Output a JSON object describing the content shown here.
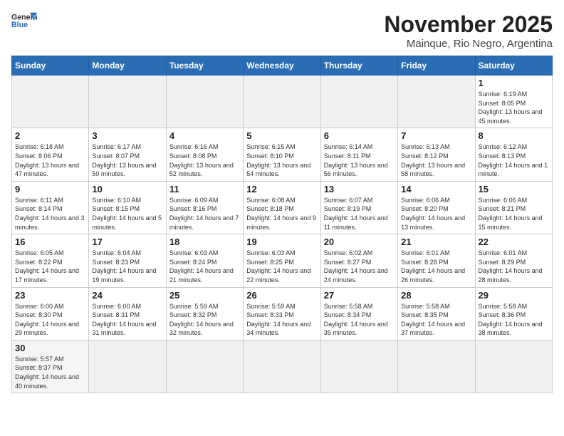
{
  "header": {
    "logo_line1": "General",
    "logo_line2": "Blue",
    "month": "November 2025",
    "location": "Mainque, Rio Negro, Argentina"
  },
  "weekdays": [
    "Sunday",
    "Monday",
    "Tuesday",
    "Wednesday",
    "Thursday",
    "Friday",
    "Saturday"
  ],
  "weeks": [
    [
      {
        "day": "",
        "info": ""
      },
      {
        "day": "",
        "info": ""
      },
      {
        "day": "",
        "info": ""
      },
      {
        "day": "",
        "info": ""
      },
      {
        "day": "",
        "info": ""
      },
      {
        "day": "",
        "info": ""
      },
      {
        "day": "1",
        "info": "Sunrise: 6:19 AM\nSunset: 8:05 PM\nDaylight: 13 hours and 45 minutes."
      }
    ],
    [
      {
        "day": "2",
        "info": "Sunrise: 6:18 AM\nSunset: 8:06 PM\nDaylight: 13 hours and 47 minutes."
      },
      {
        "day": "3",
        "info": "Sunrise: 6:17 AM\nSunset: 8:07 PM\nDaylight: 13 hours and 50 minutes."
      },
      {
        "day": "4",
        "info": "Sunrise: 6:16 AM\nSunset: 8:08 PM\nDaylight: 13 hours and 52 minutes."
      },
      {
        "day": "5",
        "info": "Sunrise: 6:15 AM\nSunset: 8:10 PM\nDaylight: 13 hours and 54 minutes."
      },
      {
        "day": "6",
        "info": "Sunrise: 6:14 AM\nSunset: 8:11 PM\nDaylight: 13 hours and 56 minutes."
      },
      {
        "day": "7",
        "info": "Sunrise: 6:13 AM\nSunset: 8:12 PM\nDaylight: 13 hours and 58 minutes."
      },
      {
        "day": "8",
        "info": "Sunrise: 6:12 AM\nSunset: 8:13 PM\nDaylight: 14 hours and 1 minute."
      }
    ],
    [
      {
        "day": "9",
        "info": "Sunrise: 6:11 AM\nSunset: 8:14 PM\nDaylight: 14 hours and 3 minutes."
      },
      {
        "day": "10",
        "info": "Sunrise: 6:10 AM\nSunset: 8:15 PM\nDaylight: 14 hours and 5 minutes."
      },
      {
        "day": "11",
        "info": "Sunrise: 6:09 AM\nSunset: 8:16 PM\nDaylight: 14 hours and 7 minutes."
      },
      {
        "day": "12",
        "info": "Sunrise: 6:08 AM\nSunset: 8:18 PM\nDaylight: 14 hours and 9 minutes."
      },
      {
        "day": "13",
        "info": "Sunrise: 6:07 AM\nSunset: 8:19 PM\nDaylight: 14 hours and 11 minutes."
      },
      {
        "day": "14",
        "info": "Sunrise: 6:06 AM\nSunset: 8:20 PM\nDaylight: 14 hours and 13 minutes."
      },
      {
        "day": "15",
        "info": "Sunrise: 6:06 AM\nSunset: 8:21 PM\nDaylight: 14 hours and 15 minutes."
      }
    ],
    [
      {
        "day": "16",
        "info": "Sunrise: 6:05 AM\nSunset: 8:22 PM\nDaylight: 14 hours and 17 minutes."
      },
      {
        "day": "17",
        "info": "Sunrise: 6:04 AM\nSunset: 8:23 PM\nDaylight: 14 hours and 19 minutes."
      },
      {
        "day": "18",
        "info": "Sunrise: 6:03 AM\nSunset: 8:24 PM\nDaylight: 14 hours and 21 minutes."
      },
      {
        "day": "19",
        "info": "Sunrise: 6:03 AM\nSunset: 8:25 PM\nDaylight: 14 hours and 22 minutes."
      },
      {
        "day": "20",
        "info": "Sunrise: 6:02 AM\nSunset: 8:27 PM\nDaylight: 14 hours and 24 minutes."
      },
      {
        "day": "21",
        "info": "Sunrise: 6:01 AM\nSunset: 8:28 PM\nDaylight: 14 hours and 26 minutes."
      },
      {
        "day": "22",
        "info": "Sunrise: 6:01 AM\nSunset: 8:29 PM\nDaylight: 14 hours and 28 minutes."
      }
    ],
    [
      {
        "day": "23",
        "info": "Sunrise: 6:00 AM\nSunset: 8:30 PM\nDaylight: 14 hours and 29 minutes."
      },
      {
        "day": "24",
        "info": "Sunrise: 6:00 AM\nSunset: 8:31 PM\nDaylight: 14 hours and 31 minutes."
      },
      {
        "day": "25",
        "info": "Sunrise: 5:59 AM\nSunset: 8:32 PM\nDaylight: 14 hours and 32 minutes."
      },
      {
        "day": "26",
        "info": "Sunrise: 5:59 AM\nSunset: 8:33 PM\nDaylight: 14 hours and 34 minutes."
      },
      {
        "day": "27",
        "info": "Sunrise: 5:58 AM\nSunset: 8:34 PM\nDaylight: 14 hours and 35 minutes."
      },
      {
        "day": "28",
        "info": "Sunrise: 5:58 AM\nSunset: 8:35 PM\nDaylight: 14 hours and 37 minutes."
      },
      {
        "day": "29",
        "info": "Sunrise: 5:58 AM\nSunset: 8:36 PM\nDaylight: 14 hours and 38 minutes."
      }
    ],
    [
      {
        "day": "30",
        "info": "Sunrise: 5:57 AM\nSunset: 8:37 PM\nDaylight: 14 hours and 40 minutes."
      },
      {
        "day": "",
        "info": ""
      },
      {
        "day": "",
        "info": ""
      },
      {
        "day": "",
        "info": ""
      },
      {
        "day": "",
        "info": ""
      },
      {
        "day": "",
        "info": ""
      },
      {
        "day": "",
        "info": ""
      }
    ]
  ]
}
